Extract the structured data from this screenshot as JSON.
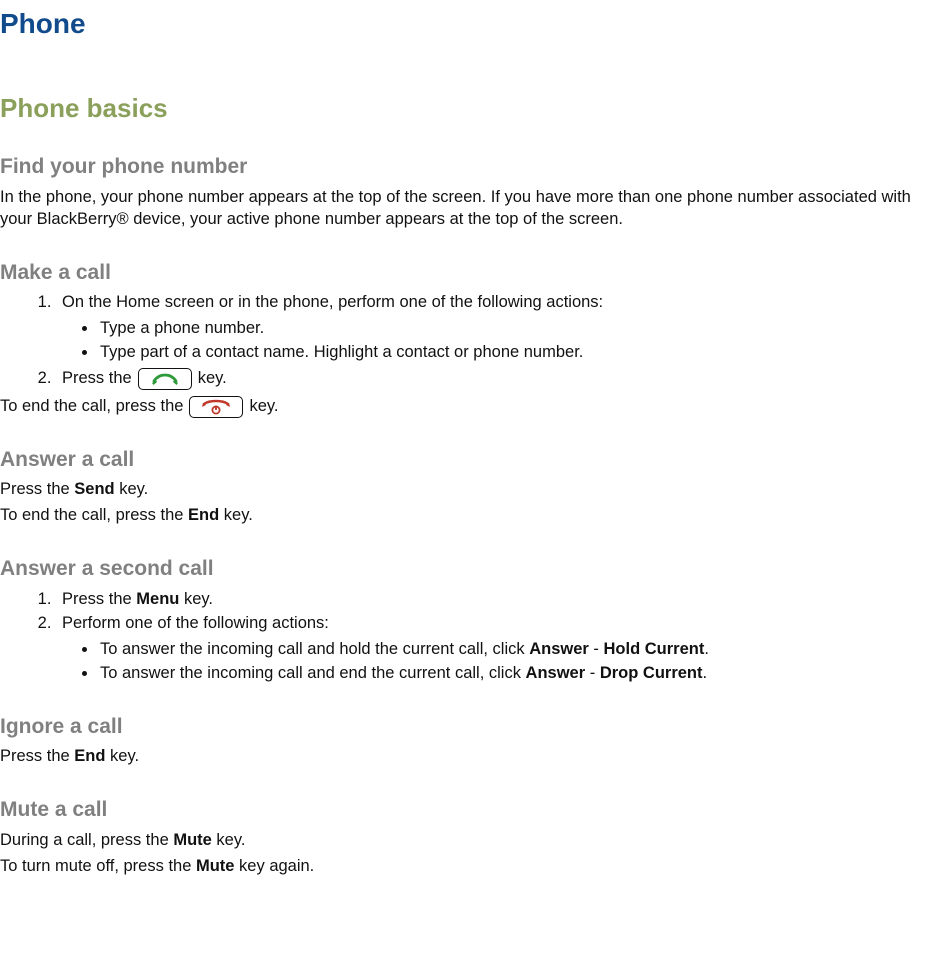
{
  "title": "Phone",
  "section": "Phone basics",
  "findNumber": {
    "heading": "Find your phone number",
    "body": "In the phone, your phone number appears at the top of the screen. If you have more than one phone number associated with your BlackBerry® device, your active phone number appears at the top of the screen."
  },
  "makeCall": {
    "heading": "Make a call",
    "step1": "On the Home screen or in the phone, perform one of the following actions:",
    "bullet1": "Type a phone number.",
    "bullet2": "Type part of a contact name. Highlight a contact or phone number.",
    "step2_pre": "Press the",
    "step2_post": "key.",
    "end_pre": "To end the call, press the",
    "end_post": "key."
  },
  "answerCall": {
    "heading": "Answer a call",
    "line1_pre": "Press the ",
    "line1_key": "Send",
    "line1_post": " key.",
    "line2_pre": "To end the call, press the ",
    "line2_key": "End",
    "line2_post": " key."
  },
  "answerSecond": {
    "heading": "Answer a second call",
    "step1_pre": "Press the ",
    "step1_key": "Menu",
    "step1_post": " key.",
    "step2": "Perform one of the following actions:",
    "b1_pre": "To answer the incoming call and hold the current call, click ",
    "b1_k1": "Answer",
    "b1_mid": " - ",
    "b1_k2": "Hold Current",
    "b1_post": ".",
    "b2_pre": "To answer the incoming call and end the current call, click ",
    "b2_k1": "Answer",
    "b2_mid": " - ",
    "b2_k2": "Drop Current",
    "b2_post": "."
  },
  "ignoreCall": {
    "heading": "Ignore a call",
    "line_pre": "Press the ",
    "line_key": "End",
    "line_post": " key."
  },
  "muteCall": {
    "heading": "Mute a call",
    "line1_pre": "During a call, press the ",
    "line1_key": "Mute",
    "line1_post": " key.",
    "line2_pre": "To turn mute off, press the ",
    "line2_key": "Mute",
    "line2_post": " key again."
  }
}
